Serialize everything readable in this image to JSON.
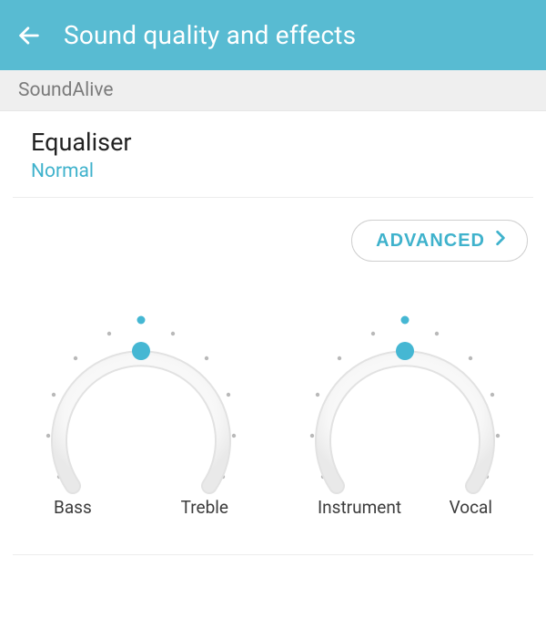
{
  "header": {
    "title": "Sound quality and effects"
  },
  "section": {
    "label": "SoundAlive"
  },
  "equaliser": {
    "title": "Equaliser",
    "value": "Normal"
  },
  "advanced": {
    "label": "ADVANCED"
  },
  "dials": [
    {
      "left_label": "Bass",
      "right_label": "Treble"
    },
    {
      "left_label": "Instrument",
      "right_label": "Vocal"
    }
  ],
  "colors": {
    "accent": "#3fb2cc",
    "header_bg": "#58bbd2"
  }
}
